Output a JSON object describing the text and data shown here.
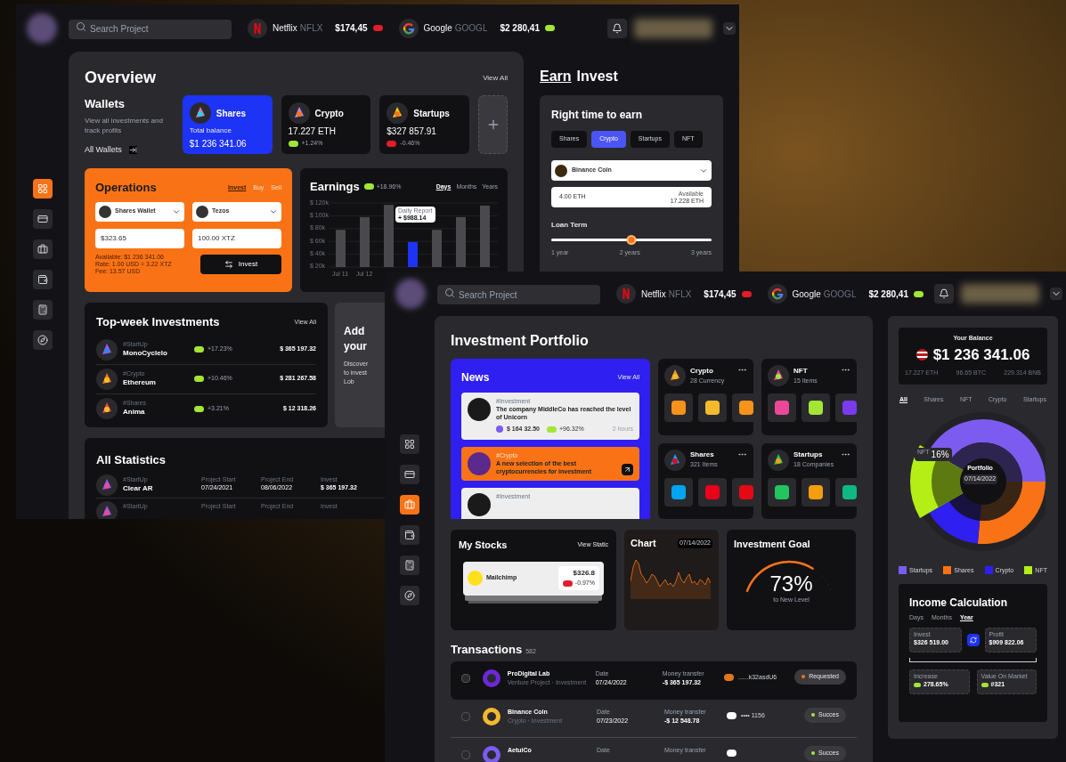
{
  "back_window": {
    "header": {
      "search": {
        "placeholder": "Search Project"
      },
      "tickers": [
        {
          "name": "Netflix",
          "symbol": "NFLX",
          "price": "$174,45",
          "positive": false
        },
        {
          "name": "Google",
          "symbol": "GOOGL",
          "price": "$2 280,41",
          "positive": true
        }
      ]
    },
    "sidebar": [
      {
        "selected": true
      },
      {
        "selected": false
      },
      {
        "selected": false
      },
      {
        "selected": false
      },
      {
        "selected": false
      },
      {
        "selected": false
      }
    ],
    "overview": {
      "title": "Overview",
      "view_all": "View All",
      "wallets": {
        "title": "Wallets",
        "subtitle": "View all investments and track profits",
        "link": "All Wallets"
      },
      "cards": [
        {
          "name": "Shares",
          "selected": true,
          "label": "Total balance",
          "amount": "$1 236 341.06"
        },
        {
          "name": "Crypto",
          "selected": false,
          "amount": "17.227 ETH",
          "change": "+1.24%",
          "positive": true
        },
        {
          "name": "Startups",
          "selected": false,
          "amount": "$327 857.91",
          "change": "-0.46%",
          "positive": false
        }
      ]
    },
    "operations": {
      "title": "Operations",
      "tabs": [
        {
          "label": "Invest",
          "selected": true
        },
        {
          "label": "Buy",
          "selected": false
        },
        {
          "label": "Sell",
          "selected": false
        }
      ],
      "from": {
        "label": "Shares Wallet",
        "value": "$323.65"
      },
      "to": {
        "label": "Tezos",
        "value": "100.00 XTZ"
      },
      "notes": [
        "Available: $1 236 341.06",
        "Rate: 1.00 USD = 3.22 XTZ",
        "Fee: 13.57 USD"
      ],
      "button": "Invest"
    },
    "earnings": {
      "title": "Earnings",
      "change": "+18.96%",
      "positive": true,
      "tabs": [
        {
          "label": "Days",
          "selected": true
        },
        {
          "label": "Months",
          "selected": false
        },
        {
          "label": "Years",
          "selected": false
        }
      ],
      "tooltip": {
        "title": "Daily Report",
        "value": "+ $988.14"
      },
      "chart_data": {
        "type": "bar",
        "categories": [
          "Jul 11",
          "Jul 12",
          null,
          null,
          null,
          null,
          null
        ],
        "series": [
          {
            "color": "#4a4a4e",
            "values": [
              78000,
              98000,
              117000,
              null,
              78000,
              98000,
              116000
            ]
          },
          {
            "color": "#1d33f5",
            "values": [
              null,
              null,
              null,
              59000,
              null,
              null,
              null
            ]
          }
        ],
        "grid": true,
        "ylim": [
          20000,
          120000
        ],
        "yticks": [
          {
            "value": 20000,
            "label": "$ 20k"
          },
          {
            "value": 40000,
            "label": "$ 40k"
          },
          {
            "value": 60000,
            "label": "$ 60k"
          },
          {
            "value": 80000,
            "label": "$ 80k"
          },
          {
            "value": 100000,
            "label": "$ 100k"
          },
          {
            "value": 120000,
            "label": "$ 120k"
          }
        ]
      }
    },
    "top_week": {
      "title": "Top-week Investments",
      "view_all": "View All",
      "rows": [
        {
          "tag": "#StartUp",
          "name": "MonoCyclelo",
          "change": "+17.23%",
          "positive": true,
          "amount": "$ 365 197.32"
        },
        {
          "tag": "#Crypto",
          "name": "Ethereum",
          "change": "+10.46%",
          "positive": true,
          "amount": "$ 281 267.58"
        },
        {
          "tag": "#Shares",
          "name": "Anima",
          "change": "+3.21%",
          "positive": true,
          "amount": "$ 12 318.26"
        }
      ]
    },
    "promo": {
      "title_lines": [
        "Add",
        "your"
      ],
      "text_lines": [
        "Discover",
        "to invest",
        "Lob"
      ]
    },
    "statistics": {
      "title": "All Statistics",
      "rows": [
        {
          "tag": "#StartUp",
          "name": "Clear AR",
          "start_label": "Project Start",
          "start": "07/24/2021",
          "end_label": "Project End",
          "end": "08/06/2022",
          "invest_label": "Invest",
          "invest": "$ 365 197.32"
        },
        {
          "tag": "#StartUp",
          "start_label": "Project Start",
          "end_label": "Project End",
          "invest_label": "Invest"
        }
      ]
    },
    "earn": {
      "tabs": [
        {
          "label": "Earn",
          "selected": true
        },
        {
          "label": "Invest",
          "selected": false
        }
      ],
      "title": "Right time to earn",
      "filters": [
        {
          "label": "Shares",
          "selected": false
        },
        {
          "label": "Crypto",
          "selected": true
        },
        {
          "label": "Startups",
          "selected": false
        },
        {
          "label": "NFT",
          "selected": false
        }
      ],
      "coin": "Binance Coin",
      "amount": "4.00 ETH",
      "available_label": "Available",
      "available": "17.228 ETH",
      "loan_title": "Loan Term",
      "loan": {
        "level": 0.5
      },
      "ticks": [
        "1 year",
        "2 years",
        "3 years"
      ]
    }
  },
  "front_window": {
    "header": {
      "search": {
        "placeholder": "Search Project"
      },
      "tickers": [
        {
          "name": "Netflix",
          "symbol": "NFLX",
          "price": "$174,45",
          "positive": false
        },
        {
          "name": "Google",
          "symbol": "GOOGL",
          "price": "$2 280,41",
          "positive": true
        }
      ]
    },
    "sidebar": [
      {
        "selected": false
      },
      {
        "selected": false
      },
      {
        "selected": true
      },
      {
        "selected": false
      },
      {
        "selected": false
      },
      {
        "selected": false
      }
    ],
    "title": "Investment Portfolio",
    "news": {
      "title": "News",
      "view_all": "View All",
      "items": [
        {
          "kind": "light",
          "tag": "#Investment",
          "text": "The company MiddleCo has reached the level of Unicorn",
          "amount": "$ 164 32.50",
          "change": "+96.32%",
          "positive": true,
          "time": "2 hours"
        },
        {
          "kind": "accent",
          "tag": "#Crypto",
          "text": "A new selection of the best cryptocurrencies for investment"
        },
        {
          "kind": "light",
          "tag": "#Investment"
        }
      ]
    },
    "categories": [
      {
        "name": "Crypto",
        "count": "28 Currency"
      },
      {
        "name": "NFT",
        "count": "15 Items"
      },
      {
        "name": "Shares",
        "count": "321 Items"
      },
      {
        "name": "Startups",
        "count": "18 Companies"
      }
    ],
    "stocks": {
      "title": "My Stocks",
      "link": "View Static",
      "name": "Mailchimp",
      "price": "$326.8",
      "change": "-0.97%",
      "positive": false
    },
    "chart": {
      "title": "Chart",
      "date": "07/14/2022"
    },
    "goal": {
      "title": "Investment Goal",
      "value": "73%",
      "caption": "to New Level",
      "level": 0.73
    },
    "transactions": {
      "title": "Transactions",
      "count": "582",
      "rows": [
        {
          "selected": true,
          "checked": false,
          "name": "ProDigital Lab",
          "sub": "Venture Project · Investment",
          "date_label": "Date",
          "date": "07/24/2022",
          "transfer_label": "Money transfer",
          "amount": "-$ 365 197.32",
          "method": "......k32asdU6",
          "status": "Requested",
          "color": "#f97316"
        },
        {
          "selected": false,
          "checked": false,
          "name": "Binance Coin",
          "sub": "Crypto · Investment",
          "date_label": "Date",
          "date": "07/23/2022",
          "transfer_label": "Money transfer",
          "amount": "-$ 12 548.78",
          "method": "•••• 1156",
          "status": "Succes",
          "color": "#a3e635"
        },
        {
          "selected": false,
          "checked": false,
          "name": "AetuiCo",
          "date_label": "Date",
          "transfer_label": "Money transfer",
          "status": "Succes",
          "color": "#a3e635"
        }
      ]
    },
    "balance": {
      "label": "Your Balance",
      "amount": "$1 236 341.06",
      "subs": [
        "17.227 ETH",
        "96.65 BTC",
        "229.314 BNB"
      ]
    },
    "filters": [
      {
        "label": "All",
        "selected": true
      },
      {
        "label": "Shares",
        "selected": false
      },
      {
        "label": "NFT",
        "selected": false
      },
      {
        "label": "Crypto",
        "selected": false
      },
      {
        "label": "Startups",
        "selected": false
      }
    ],
    "donut": {
      "title": "Portfolio",
      "date": "07/14/2022",
      "callout_label": "NFT",
      "callout": "16%"
    },
    "legend": [
      {
        "label": "Startups",
        "color": "#7c5cf0"
      },
      {
        "label": "Shares",
        "color": "#f97316"
      },
      {
        "label": "Crypto",
        "color": "#2f1ff0"
      },
      {
        "label": "NFT",
        "color": "#b4ee16"
      }
    ],
    "income": {
      "title": "Income Calculation",
      "tabs": [
        {
          "label": "Days",
          "selected": false
        },
        {
          "label": "Months",
          "selected": false
        },
        {
          "label": "Year",
          "selected": true
        }
      ],
      "invest_label": "Invest",
      "invest": "$326 519.00",
      "profit_label": "Profit",
      "profit": "$909 822.06",
      "increase_label": "Increase",
      "increase": "278.65%",
      "market_label": "Value On Market",
      "market": "#321"
    }
  }
}
